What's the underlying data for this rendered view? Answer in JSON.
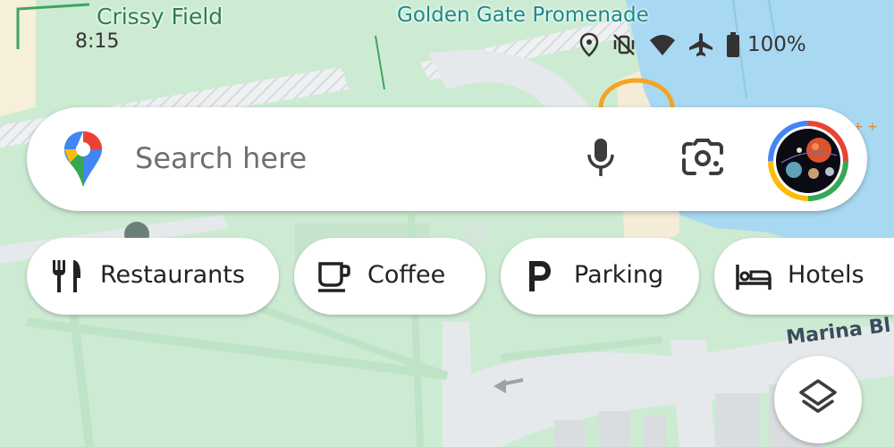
{
  "status_bar": {
    "time": "8:15",
    "battery_percent": "100%",
    "icons": [
      "location-icon",
      "vibrate-off-icon",
      "wifi-icon",
      "airplane-icon",
      "battery-icon"
    ]
  },
  "map": {
    "labels": {
      "crissy_field": "Crissy Field",
      "promenade": "Golden Gate Promenade",
      "marina": "Marina Bl"
    }
  },
  "search": {
    "placeholder": "Search here",
    "icons": [
      "maps-pin-logo-icon",
      "mic-icon",
      "lens-camera-icon"
    ]
  },
  "chips": [
    {
      "label": "Restaurants",
      "icon": "fork-knife-icon"
    },
    {
      "label": "Coffee",
      "icon": "coffee-cup-icon"
    },
    {
      "label": "Parking",
      "icon": "parking-p-icon"
    },
    {
      "label": "Hotels",
      "icon": "bed-icon"
    }
  ],
  "colors": {
    "park_green": "#cdebd3",
    "water_blue": "#a9d8f2",
    "road_gray": "#e6e9ec",
    "chip_bg": "#ffffff"
  }
}
